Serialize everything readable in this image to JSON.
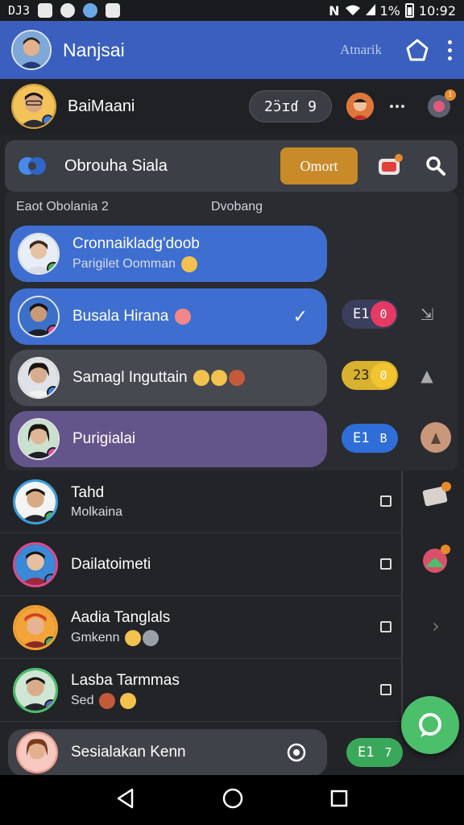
{
  "status_bar": {
    "carrier": "DJ3",
    "battery": "1%",
    "time": "10:92",
    "icons": [
      "b-icon",
      "circle-icon",
      "globe-icon",
      "person-icon",
      "n-icon",
      "wifi-icon",
      "signal-icon",
      "battery-icon"
    ]
  },
  "app_bar": {
    "title": "Nanjsai",
    "action": "Atnarik",
    "icons": [
      "avatar",
      "bell-icon",
      "more-vert-icon"
    ],
    "color": "#3a5fbe"
  },
  "profile": {
    "name": "BaiMaani",
    "counter": "2ɔ̈ɪɗ 9",
    "icons": [
      "small-avatar",
      "more-horiz-icon",
      "notification-badge-icon"
    ]
  },
  "search": {
    "title": "Obrouha Siala",
    "button": "Omort",
    "icons": [
      "group-logo-icon",
      "chat-badge-icon",
      "search-icon"
    ],
    "button_color": "#c98a2a"
  },
  "section_labels": {
    "left": "Eaot Obolania 2",
    "right": "Dvobang"
  },
  "cards": [
    {
      "title": "Cronnaikladg'doob",
      "subtitle": "Parigilet Oomman",
      "color": "#3e6fd0"
    },
    {
      "title": "Busala Hirana",
      "color": "#3e6fd0",
      "count": "E1",
      "knob": "0",
      "pill_color": "#3b3e5c",
      "knob_color": "#e63a63"
    },
    {
      "title": "Samagl Inguttain",
      "color": "#46494f",
      "count": "23",
      "knob": "0",
      "pill_color": "#d7b12f",
      "knob_color": "#f2c430"
    },
    {
      "title": "Purigialai",
      "color": "#63558a",
      "count": "E1",
      "knob": "B",
      "pill_color": "#2f6ed6",
      "knob_color": "#2f6ed6"
    }
  ],
  "list": [
    {
      "title": "Tahd",
      "subtitle": "Molkaina"
    },
    {
      "title": "Dailatoimeti",
      "subtitle": ""
    },
    {
      "title": "Aadia Tanglals",
      "subtitle": "Gmkenn"
    },
    {
      "title": "Lasba Tarmmas",
      "subtitle": "Sed"
    }
  ],
  "bottom_card": {
    "title": "Sesialakan Kenn",
    "count": "E1",
    "knob": "7"
  },
  "accent_colors": {
    "fab": "#4cbf6a",
    "badge": "#e8892e"
  }
}
